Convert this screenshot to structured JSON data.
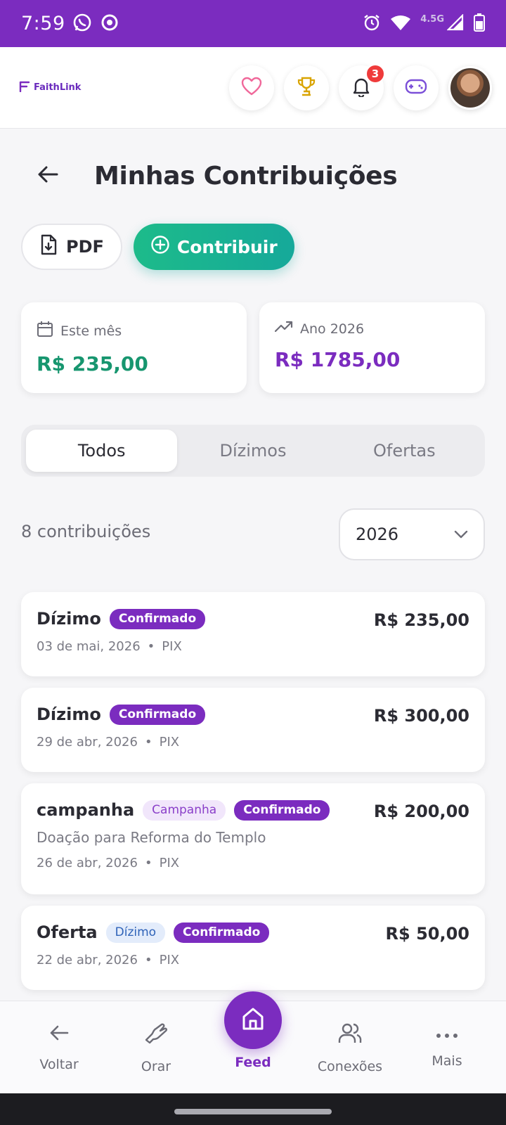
{
  "status_bar": {
    "time": "7:59",
    "network": "4.5G"
  },
  "header": {
    "logo_text": "FaithLink",
    "notification_count": "3"
  },
  "page": {
    "title": "Minhas Contribuições"
  },
  "actions": {
    "pdf_label": "PDF",
    "contribute_label": "Contribuir"
  },
  "summary": {
    "month_label": "Este mês",
    "month_value": "R$ 235,00",
    "year_label": "Ano 2026",
    "year_value": "R$ 1785,00"
  },
  "tabs": [
    {
      "label": "Todos",
      "active": true
    },
    {
      "label": "Dízimos",
      "active": false
    },
    {
      "label": "Ofertas",
      "active": false
    }
  ],
  "filter": {
    "count_label": "8 contribuições",
    "year_selected": "2026"
  },
  "contributions": [
    {
      "title": "Dízimo",
      "status": "Confirmado",
      "amount": "R$ 235,00",
      "date": "03 de mai, 2026",
      "method": "PIX"
    },
    {
      "title": "Dízimo",
      "status": "Confirmado",
      "amount": "R$ 300,00",
      "date": "29 de abr, 2026",
      "method": "PIX"
    },
    {
      "title": "campanha",
      "tag": "Campanha",
      "status": "Confirmado",
      "amount": "R$ 200,00",
      "description": "Doação para Reforma do Templo",
      "date": "26 de abr, 2026",
      "method": "PIX"
    },
    {
      "title": "Oferta",
      "tag": "Dízimo",
      "status": "Confirmado",
      "amount": "R$ 50,00",
      "date": "22 de abr, 2026",
      "method": "PIX"
    }
  ],
  "meta_separator": "•",
  "bottom_nav": {
    "back": "Voltar",
    "pray": "Orar",
    "feed": "Feed",
    "connections": "Conexões",
    "more": "Mais"
  },
  "colors": {
    "brand_purple": "#7b2cbf",
    "accent_green": "#17966f",
    "badge_red": "#ef3b3b"
  }
}
